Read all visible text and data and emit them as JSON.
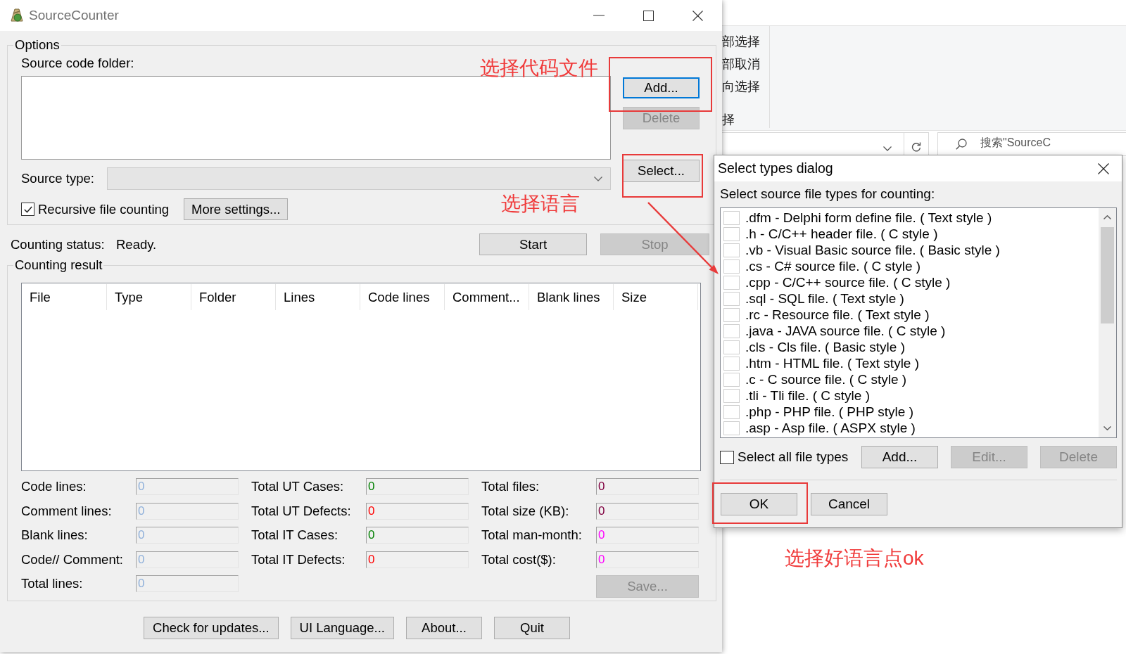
{
  "main_window": {
    "title": "SourceCounter",
    "options": {
      "title": "Options",
      "folder_label": "Source code folder:",
      "add_button": {
        "label": "Add...",
        "disabled": false,
        "focused": true
      },
      "delete_button": {
        "label": "Delete",
        "disabled": true
      },
      "source_type_label": "Source type:",
      "source_type_combo": {
        "disabled": true
      },
      "select_button": {
        "label": "Select...",
        "disabled": false
      },
      "recursive": {
        "label": "Recursive file counting",
        "checked": true
      },
      "more_settings_button": {
        "label": "More settings...",
        "disabled": false
      }
    },
    "status": {
      "label": "Counting status:",
      "value": "Ready."
    },
    "start_button": {
      "label": "Start",
      "disabled": false
    },
    "stop_button": {
      "label": "Stop",
      "disabled": true
    },
    "result": {
      "title": "Counting result",
      "columns": [
        "File",
        "Type",
        "Folder",
        "Lines",
        "Code lines",
        "Comment...",
        "Blank lines",
        "Size"
      ],
      "stat_columns": [
        [
          {
            "label": "Code lines:",
            "value": "0",
            "color": "#8fb0da"
          },
          {
            "label": "Comment lines:",
            "value": "0",
            "color": "#8fb0da"
          },
          {
            "label": "Blank lines:",
            "value": "0",
            "color": "#8fb0da"
          },
          {
            "label": "Code// Comment:",
            "value": "0",
            "color": "#8fb0da"
          },
          {
            "label": "Total lines:",
            "value": "0",
            "color": "#8fb0da"
          }
        ],
        [
          {
            "label": "Total UT Cases:",
            "value": "0",
            "color": "#008000"
          },
          {
            "label": "Total UT Defects:",
            "value": "0",
            "color": "#ff0000"
          },
          {
            "label": "Total IT Cases:",
            "value": "0",
            "color": "#008000"
          },
          {
            "label": "Total IT Defects:",
            "value": "0",
            "color": "#ff0000"
          }
        ],
        [
          {
            "label": "Total files:",
            "value": "0",
            "color": "#800040"
          },
          {
            "label": "Total size (KB):",
            "value": "0",
            "color": "#800040"
          },
          {
            "label": "Total man-month:",
            "value": "0",
            "color": "#ff00ff"
          },
          {
            "label": "Total cost($):",
            "value": "0",
            "color": "#ff00ff"
          }
        ]
      ],
      "save_button": {
        "label": "Save...",
        "disabled": true
      }
    },
    "bottom_buttons": [
      {
        "label": "Check for updates...",
        "disabled": false
      },
      {
        "label": "UI Language...",
        "disabled": false
      },
      {
        "label": "About...",
        "disabled": false
      },
      {
        "label": "Quit",
        "disabled": false
      }
    ]
  },
  "background_window": {
    "ribbon_items": [
      "部选择",
      "部取消",
      "向选择",
      "择"
    ],
    "search": {
      "placeholder": "搜索\"SourceC"
    }
  },
  "select_types_dialog": {
    "title": "Select types dialog",
    "prompt": "Select source file types for counting:",
    "file_types": [
      {
        "label": ".dfm - Delphi form define file. ( Text style )",
        "checked": false
      },
      {
        "label": ".h - C/C++ header file. ( C style )",
        "checked": false
      },
      {
        "label": ".vb - Visual Basic source file. ( Basic style )",
        "checked": false
      },
      {
        "label": ".cs - C# source file. ( C style )",
        "checked": false
      },
      {
        "label": ".cpp - C/C++ source file. ( C style )",
        "checked": false
      },
      {
        "label": ".sql - SQL file. ( Text style )",
        "checked": false
      },
      {
        "label": ".rc - Resource file. ( Text style )",
        "checked": false
      },
      {
        "label": ".java - JAVA source file. ( C style )",
        "checked": false
      },
      {
        "label": ".cls - Cls file. ( Basic style )",
        "checked": false
      },
      {
        "label": ".htm - HTML file. ( Text style )",
        "checked": false
      },
      {
        "label": ".c - C source file. ( C style )",
        "checked": false
      },
      {
        "label": ".tli - Tli file. ( C style )",
        "checked": false
      },
      {
        "label": ".php - PHP file. ( PHP style )",
        "checked": false
      },
      {
        "label": ".asp - Asp file. ( ASPX style )",
        "checked": false
      }
    ],
    "select_all": {
      "label": "Select all file types",
      "checked": false
    },
    "buttons": [
      {
        "label": "Add...",
        "disabled": false
      },
      {
        "label": "Edit...",
        "disabled": true
      },
      {
        "label": "Delete",
        "disabled": true
      }
    ],
    "footer_buttons": [
      {
        "label": "OK",
        "disabled": false
      },
      {
        "label": "Cancel",
        "disabled": false
      }
    ]
  },
  "annotations": [
    {
      "kind": "highlight"
    },
    {
      "kind": "note",
      "text": "选择代码文件"
    },
    {
      "kind": "highlight"
    },
    {
      "kind": "note",
      "text": "选择语言"
    },
    {
      "kind": "arrow"
    },
    {
      "kind": "highlight"
    },
    {
      "kind": "note",
      "text": "选择好语言点ok"
    }
  ]
}
